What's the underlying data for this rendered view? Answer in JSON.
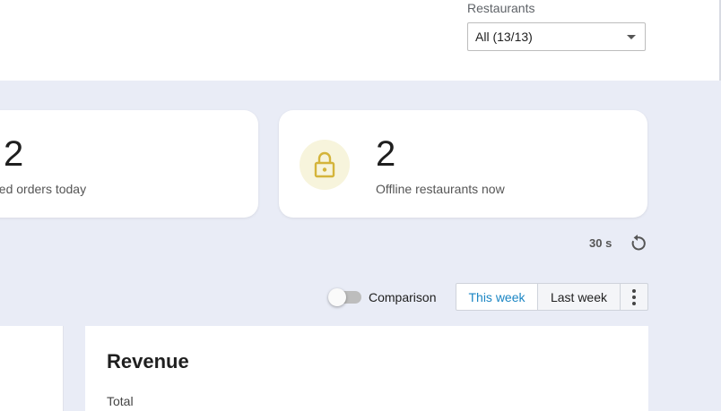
{
  "filters": {
    "restaurants_label": "Restaurants",
    "restaurants_value": "All (13/13)"
  },
  "stats": {
    "cancelled": {
      "value": "2",
      "caption": "ncelled orders today"
    },
    "offline": {
      "value": "2",
      "caption": "Offline restaurants now",
      "icon": "lock-icon",
      "icon_color": "#d4b43a",
      "icon_bg": "#f7f4dc"
    }
  },
  "refresh": {
    "interval": "30 s",
    "icon": "refresh-icon"
  },
  "comparison": {
    "label": "Comparison",
    "enabled": false
  },
  "period": {
    "options": [
      "This week",
      "Last week"
    ],
    "selected": "This week",
    "more_icon": "more-vertical-icon"
  },
  "revenue": {
    "title": "Revenue",
    "subtitle": "Total"
  },
  "colors": {
    "accent": "#1b86c4",
    "background": "#e9ecf6"
  }
}
